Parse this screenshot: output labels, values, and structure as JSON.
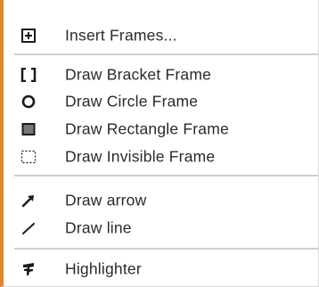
{
  "menu": {
    "accent_color": "#e2852f",
    "items": [
      {
        "label": "Insert Frames...",
        "icon": "insert-frames-icon"
      },
      {
        "label": "Draw Bracket Frame",
        "icon": "bracket-frame-icon"
      },
      {
        "label": "Draw Circle Frame",
        "icon": "circle-frame-icon"
      },
      {
        "label": "Draw Rectangle Frame",
        "icon": "rectangle-frame-icon"
      },
      {
        "label": "Draw Invisible Frame",
        "icon": "invisible-frame-icon"
      },
      {
        "label": "Draw arrow",
        "icon": "arrow-icon"
      },
      {
        "label": "Draw line",
        "icon": "line-icon"
      },
      {
        "label": "Highlighter",
        "icon": "highlighter-icon"
      }
    ]
  }
}
